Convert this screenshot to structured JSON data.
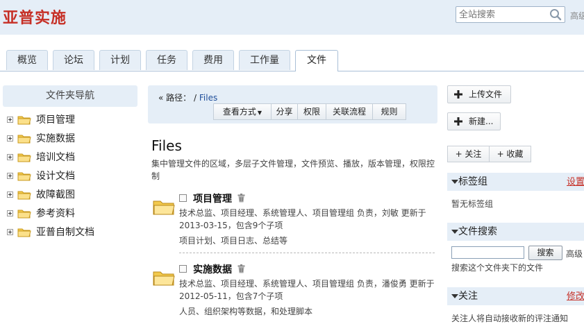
{
  "header": {
    "logo": "亚普实施",
    "search_placeholder": "全站搜索",
    "advanced_link": "高级"
  },
  "tabs": [
    {
      "label": "概览"
    },
    {
      "label": "论坛"
    },
    {
      "label": "计划"
    },
    {
      "label": "任务"
    },
    {
      "label": "费用"
    },
    {
      "label": "工作量"
    },
    {
      "label": "文件",
      "active": true
    }
  ],
  "sidebar": {
    "title": "文件夹导航",
    "items": [
      {
        "label": "项目管理"
      },
      {
        "label": "实施数据"
      },
      {
        "label": "培训文档"
      },
      {
        "label": "设计文档"
      },
      {
        "label": "故障截图"
      },
      {
        "label": "参考资料"
      },
      {
        "label": "亚普自制文档"
      }
    ]
  },
  "path": {
    "label": "« 路径：",
    "separator": "/",
    "current": "Files"
  },
  "toolbar": {
    "view_mode": "查看方式",
    "share": "分享",
    "permissions": "权限",
    "linked_flow": "关联流程",
    "rules": "规则"
  },
  "main": {
    "title": "Files",
    "description": "集中管理文件的区域，多层子文件管理，文件预览、播放，版本管理，权限控制",
    "entries": [
      {
        "name": "项目管理",
        "meta": "技术总监、项目经理、系统管理人、项目管理组 负责，刘敏 更新于 2013-03-15，包含9个子项",
        "tags": "项目计划、项目日志、总结等"
      },
      {
        "name": "实施数据",
        "meta": "技术总监、项目经理、系统管理人、项目管理组 负责，潘俊勇 更新于 2012-05-11，包含7个子项",
        "tags": "人员、组织架构等数据，和处理脚本"
      }
    ]
  },
  "right": {
    "upload": "上传文件",
    "new": "新建...",
    "follow": "+ 关注",
    "favorite": "+ 收藏",
    "tags_section": {
      "title": "标签组",
      "action": "设置",
      "empty": "暂无标签组"
    },
    "file_search": {
      "title": "文件搜索",
      "button": "搜索",
      "advanced": "高级",
      "hint": "搜索这个文件夹下的文件"
    },
    "follow_section": {
      "title": "关注",
      "action": "修改",
      "note": "关注人将自动接收新的评注通知"
    }
  },
  "colors": {
    "brand_red": "#c62f26",
    "header_bg": "#e5eef7",
    "link_blue": "#1f4e9a"
  }
}
